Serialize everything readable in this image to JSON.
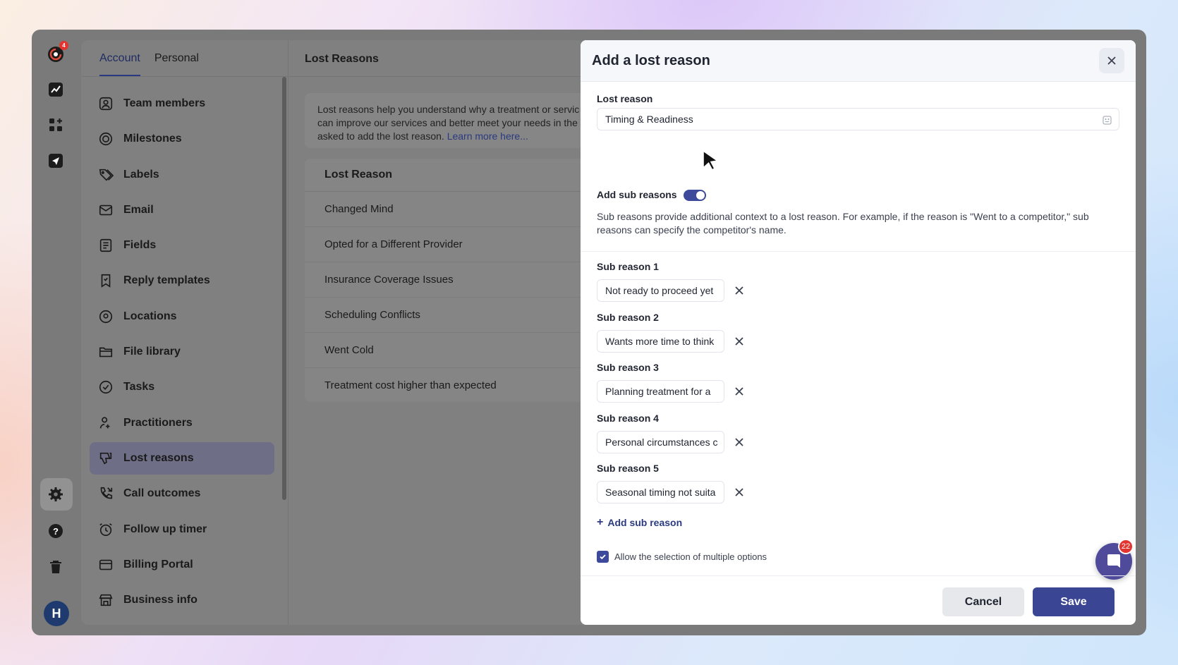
{
  "rail": {
    "logo_badge": "4",
    "avatar_initial": "H",
    "icons": [
      "logo-icon",
      "analytics-icon",
      "apps-add-icon",
      "send-icon",
      "settings-icon",
      "help-icon",
      "trash-icon"
    ]
  },
  "settings_tabs": [
    {
      "label": "Account",
      "active": true
    },
    {
      "label": "Personal",
      "active": false
    }
  ],
  "nav": {
    "items": [
      {
        "label": "Team members",
        "icon": "user-square-icon"
      },
      {
        "label": "Milestones",
        "icon": "target-icon"
      },
      {
        "label": "Labels",
        "icon": "tag-icon"
      },
      {
        "label": "Email",
        "icon": "mail-icon"
      },
      {
        "label": "Fields",
        "icon": "form-fields-icon"
      },
      {
        "label": "Reply templates",
        "icon": "bookmark-icon"
      },
      {
        "label": "Locations",
        "icon": "location-pin-icon"
      },
      {
        "label": "File library",
        "icon": "folder-icon"
      },
      {
        "label": "Tasks",
        "icon": "check-circle-icon"
      },
      {
        "label": "Practitioners",
        "icon": "practitioner-icon"
      },
      {
        "label": "Lost reasons",
        "icon": "thumbs-down-icon",
        "active": true
      },
      {
        "label": "Call outcomes",
        "icon": "phone-call-icon"
      },
      {
        "label": "Follow up timer",
        "icon": "alarm-clock-icon"
      },
      {
        "label": "Billing Portal",
        "icon": "credit-card-icon"
      },
      {
        "label": "Business info",
        "icon": "store-icon"
      }
    ]
  },
  "content": {
    "title": "Lost Reasons",
    "info_line1": "Lost reasons help you understand why a treatment or servic",
    "info_line2": "can improve our services and better meet your needs in the",
    "info_line3": "asked to add the lost reason. ",
    "info_link": "Learn more here...",
    "table_header": "Lost Reason",
    "rows": [
      "Changed Mind",
      "Opted for a Different Provider",
      "Insurance Coverage Issues",
      "Scheduling Conflicts",
      "Went Cold",
      "Treatment cost higher than expected"
    ]
  },
  "modal": {
    "title": "Add a lost reason",
    "lost_reason_label": "Lost reason",
    "lost_reason_value": "Timing & Readiness",
    "add_sub_label": "Add sub reasons",
    "add_sub_enabled": true,
    "help_text": "Sub reasons provide additional context to a lost reason. For example, if the reason is \"Went to a competitor,\" sub reasons can specify the competitor's name.",
    "sub_reasons": [
      {
        "label": "Sub reason 1",
        "value": "Not ready to proceed yet"
      },
      {
        "label": "Sub reason 2",
        "value": "Wants more time to think"
      },
      {
        "label": "Sub reason 3",
        "value": "Planning treatment for a"
      },
      {
        "label": "Sub reason 4",
        "value": "Personal circumstances c"
      },
      {
        "label": "Sub reason 5",
        "value": "Seasonal timing not suita"
      }
    ],
    "add_sub_reason": "Add sub reason",
    "allow_multiple_label": "Allow the selection of multiple options",
    "allow_multiple_checked": true,
    "cancel": "Cancel",
    "save": "Save"
  },
  "chat": {
    "badge": "22"
  },
  "colors": {
    "accent": "#3a4694",
    "toggle": "#3d4a9c",
    "badge": "#e3342f"
  }
}
